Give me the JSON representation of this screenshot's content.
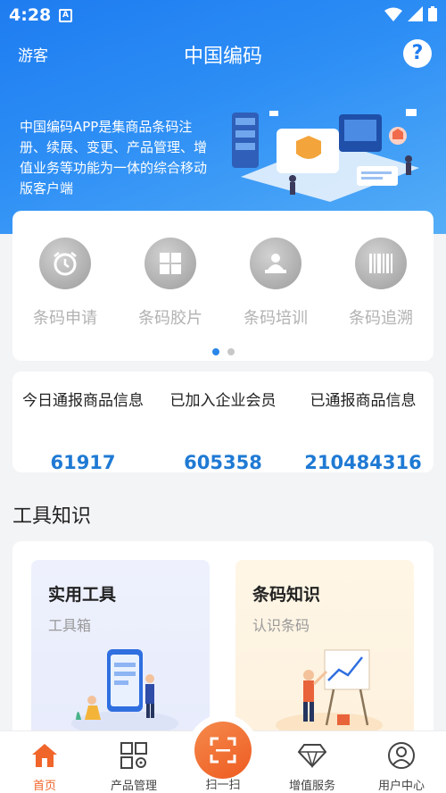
{
  "status_bar": {
    "time": "4:28",
    "app_badge": "A"
  },
  "nav": {
    "left_label": "游客",
    "title": "中国编码",
    "help_icon": "question-icon"
  },
  "banner": {
    "text": "中国编码APP是集商品条码注册、续展、变更、产品管理、增值业务等功能为一体的综合移动版客户端"
  },
  "quick_menu": {
    "items": [
      {
        "label": "条码申请",
        "icon": "alarm-clock-icon"
      },
      {
        "label": "条码胶片",
        "icon": "grid-tiles-icon"
      },
      {
        "label": "条码培训",
        "icon": "trainer-icon"
      },
      {
        "label": "条码追溯",
        "icon": "barcode-icon"
      }
    ],
    "page_count": 2,
    "active_page": 1
  },
  "stats": [
    {
      "label": "今日通报商品信息",
      "value": "61917"
    },
    {
      "label": "已加入企业会员",
      "value": "605358"
    },
    {
      "label": "已通报商品信息",
      "value": "210484316"
    }
  ],
  "section": {
    "title": "工具知识"
  },
  "tools": [
    {
      "title": "实用工具",
      "subtitle": "工具箱"
    },
    {
      "title": "条码知识",
      "subtitle": "认识条码"
    }
  ],
  "bottom_nav": {
    "items": [
      {
        "label": "首页",
        "icon": "home-icon",
        "active": true
      },
      {
        "label": "产品管理",
        "icon": "grid-gear-icon",
        "active": false
      },
      {
        "label": "增值服务",
        "icon": "diamond-icon",
        "active": false
      },
      {
        "label": "用户中心",
        "icon": "user-circle-icon",
        "active": false
      }
    ],
    "scan_label": "扫一扫"
  },
  "colors": {
    "primary": "#1e7cf0",
    "accent": "#ee5b21",
    "stat_value": "#1f7ad4"
  }
}
